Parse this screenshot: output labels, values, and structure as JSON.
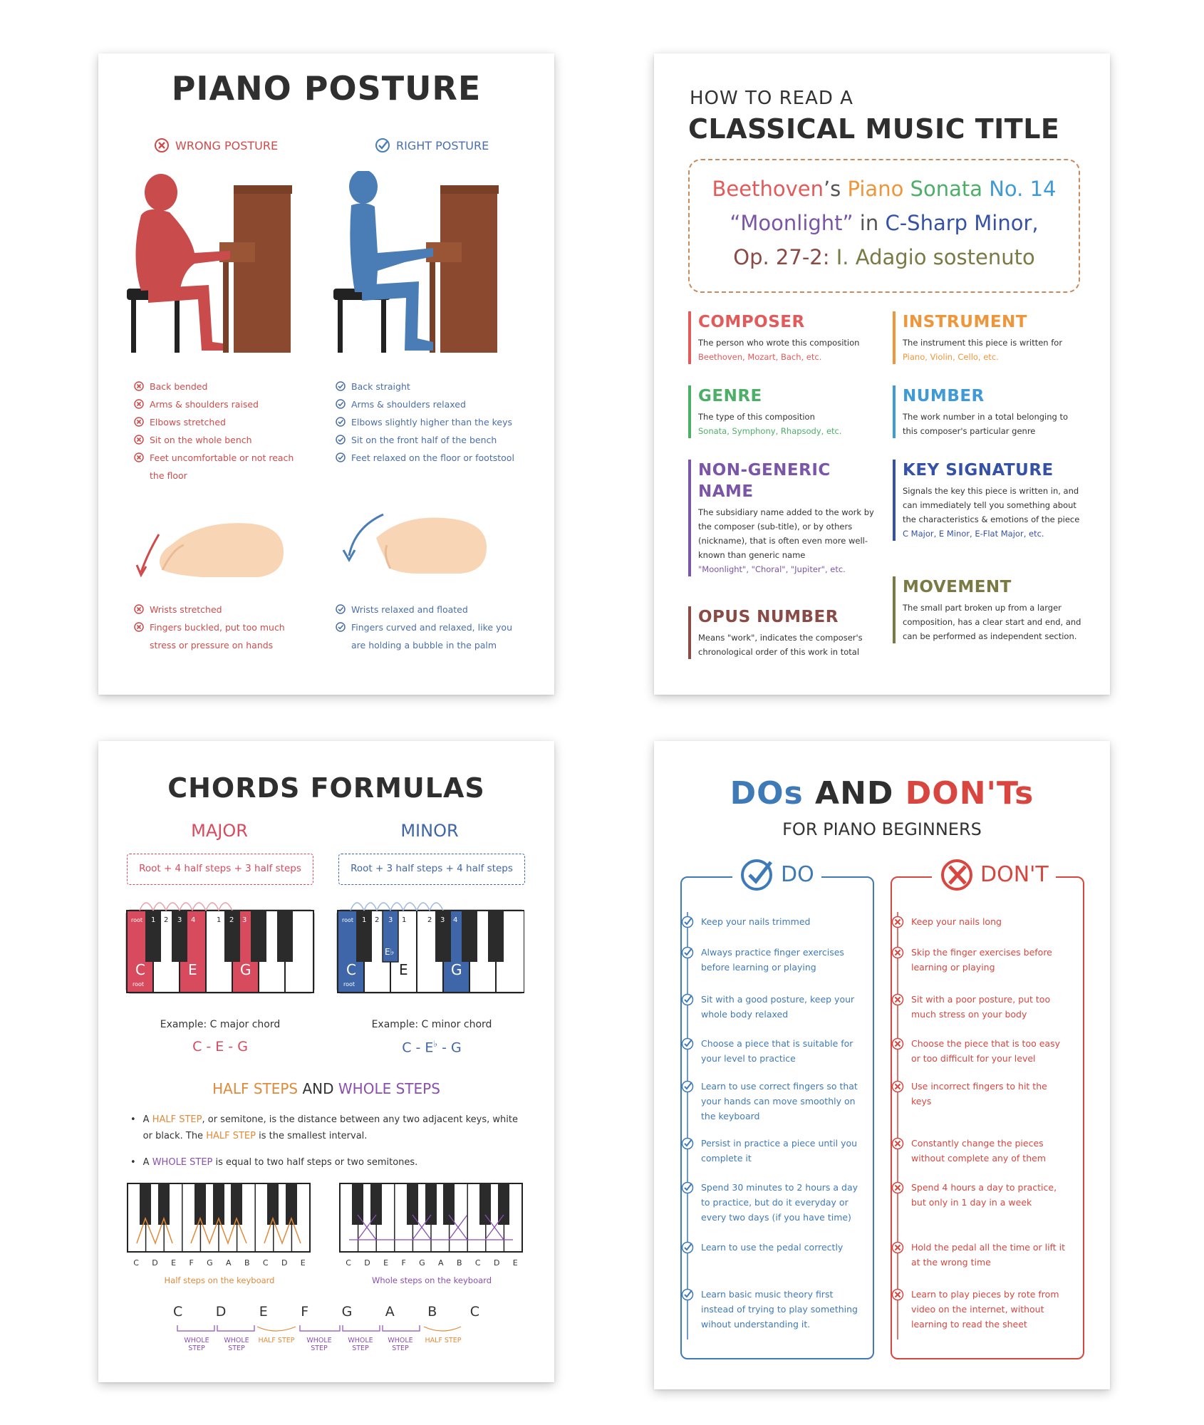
{
  "posture": {
    "title": "PIANO POSTURE",
    "wrong_label": "WRONG POSTURE",
    "right_label": "RIGHT POSTURE",
    "wrong_items": [
      "Back bended",
      "Arms & shoulders raised",
      "Elbows stretched",
      "Sit on the whole bench",
      "Feet uncomfortable or not reach the floor"
    ],
    "right_items": [
      "Back straight",
      "Arms & shoulders relaxed",
      "Elbows slightly higher than the keys",
      "Sit on the front half of the bench",
      "Feet relaxed on the floor or footstool"
    ],
    "wrong_hand_items": [
      "Wrists stretched",
      "Fingers buckled, put too much stress or pressure on hands"
    ],
    "right_hand_items": [
      "Wrists relaxed and floated",
      "Fingers curved and relaxed, like you are holding a bubble in the palm"
    ],
    "colors": {
      "wrong": "#cf4b4b",
      "right": "#4a7db5",
      "piano": "#8b4a2f"
    }
  },
  "title_guide": {
    "kicker": "HOW TO READ A",
    "title": "CLASSICAL MUSIC TITLE",
    "example": {
      "composer": "Beethoven",
      "apostrophe": "’s",
      "instrument": "Piano",
      "genre": "Sonata",
      "number": "No. 14",
      "name": "“Moonlight”",
      "in": " in ",
      "key": "C-Sharp Minor,",
      "opus": "Op. 27-2:",
      "movement": "I. Adagio sostenuto"
    },
    "categories": [
      {
        "id": "composer",
        "title": "COMPOSER",
        "desc": "The person who wrote this composition",
        "ex": "Beethoven, Mozart, Bach, etc.",
        "color": "#e25a5a"
      },
      {
        "id": "instrument",
        "title": "INSTRUMENT",
        "desc": "The instrument this piece is written for",
        "ex": "Piano, Violin, Cello, etc.",
        "color": "#f0963a"
      },
      {
        "id": "genre",
        "title": "GENRE",
        "desc": "The type of this composition",
        "ex": "Sonata, Symphony, Rhapsody, etc.",
        "color": "#4caf68"
      },
      {
        "id": "number",
        "title": "NUMBER",
        "desc": "The work number in a total belonging to this composer's particular genre",
        "ex": "",
        "color": "#3f9ad6"
      },
      {
        "id": "name",
        "title": "NON-GENERIC NAME",
        "desc": "The subsidiary name added to the work by the composer (sub-title), or by others (nickname), that is often even more well-known than generic name",
        "ex": "\"Moonlight\", \"Choral\", \"Jupiter\", etc.",
        "color": "#7a55a8"
      },
      {
        "id": "key",
        "title": "KEY SIGNATURE",
        "desc": "Signals the key this piece is written in, and can immediately tell you something about the characteristics & emotions of the piece",
        "ex": "C Major, E Minor, E-Flat Major, etc.",
        "color": "#3552a8"
      },
      {
        "id": "opus",
        "title": "OPUS NUMBER",
        "desc": "Means \"work\", indicates the composer's chronological order of this work in total",
        "ex": "",
        "color": "#8a4a45"
      },
      {
        "id": "movement",
        "title": "MOVEMENT",
        "desc": "The small part broken up from a larger composition, has a clear start and end, and can be performed as independent section.",
        "ex": "",
        "color": "#7a7a45"
      }
    ]
  },
  "chords": {
    "title": "CHORDS FORMULAS",
    "major": {
      "label": "MAJOR",
      "formula": "Root + 4 half steps + 3 half steps",
      "example": "Example: C major chord",
      "notes": "C - E - G",
      "color": "#d84a5e"
    },
    "minor": {
      "label": "MINOR",
      "formula": "Root + 3 half steps + 4 half steps",
      "example": "Example: C minor chord",
      "notes_a": "C - E",
      "flat": "♭",
      "notes_b": " - G",
      "color": "#3f66a8"
    },
    "root": "root",
    "note_c": "C",
    "note_e": "E",
    "note_g": "G",
    "note_eb": "E♭",
    "major_counts": [
      "1",
      "2",
      "3",
      "4",
      "1",
      "2",
      "3"
    ],
    "minor_counts": [
      "1",
      "2",
      "3",
      "1",
      "2",
      "3",
      "4"
    ],
    "steps_heading": {
      "half": "HALF STEPS",
      "and": " AND ",
      "whole": "WHOLE STEPS"
    },
    "bullet1": {
      "a": "A ",
      "half": "HALF STEP",
      "b": ", or semitone, is the distance between any two adjacent keys, white or black. The ",
      "half2": "HALF STEP",
      "c": " is the smallest interval."
    },
    "bullet2": {
      "a": "A ",
      "whole": "WHOLE STEP",
      "b": " is equal to two half steps or two semitones."
    },
    "key_letters": [
      "C",
      "D",
      "E",
      "F",
      "G",
      "A",
      "B",
      "C",
      "D",
      "E"
    ],
    "half_caption": "Half steps on the keyboard",
    "whole_caption": "Whole steps on the keyboard",
    "scale_notes": [
      "C",
      "D",
      "E",
      "F",
      "G",
      "A",
      "B",
      "C"
    ],
    "scale_steps": [
      "WHOLE STEP",
      "WHOLE STEP",
      "HALF STEP",
      "WHOLE STEP",
      "WHOLE STEP",
      "WHOLE STEP",
      "HALF STEP"
    ],
    "colors": {
      "half": "#e08a3a",
      "whole": "#8a4fb0"
    }
  },
  "dos": {
    "title_do": "DOs",
    "title_and": " AND ",
    "title_dont": "DON'Ts",
    "subtitle": "FOR PIANO BEGINNERS",
    "do_label": "DO",
    "dont_label": "DON'T",
    "do_items": [
      "Keep your nails trimmed",
      "Always practice finger exercises before learning or playing",
      "Sit with a good posture, keep your whole body relaxed",
      "Choose a piece that is suitable for your level to practice",
      "Learn to use correct fingers so that your hands can move smoothly on the keyboard",
      "Persist in practice a piece until you complete it",
      "Spend 30 minutes to 2 hours a day to practice, but do it everyday or every two days (if you have time)",
      "Learn to use the pedal correctly",
      "Learn basic music theory first instead of trying to play something wihout understanding it."
    ],
    "dont_items": [
      "Keep your nails long",
      "Skip the finger exercises before learning or playing",
      "Sit with a poor posture, put too much stress on your body",
      "Choose the piece that is too easy or too difficult for your level",
      "Use incorrect fingers to hit the keys",
      "Constantly change the pieces without complete any of them",
      "Spend 4 hours a day to practice, but only in 1 day in a week",
      "Hold the pedal all the time or lift it at the wrong time",
      "Learn to play pieces by rote from video on the internet, without learning to read the sheet"
    ],
    "colors": {
      "do": "#3f7ab8",
      "dont": "#d8463f"
    }
  }
}
